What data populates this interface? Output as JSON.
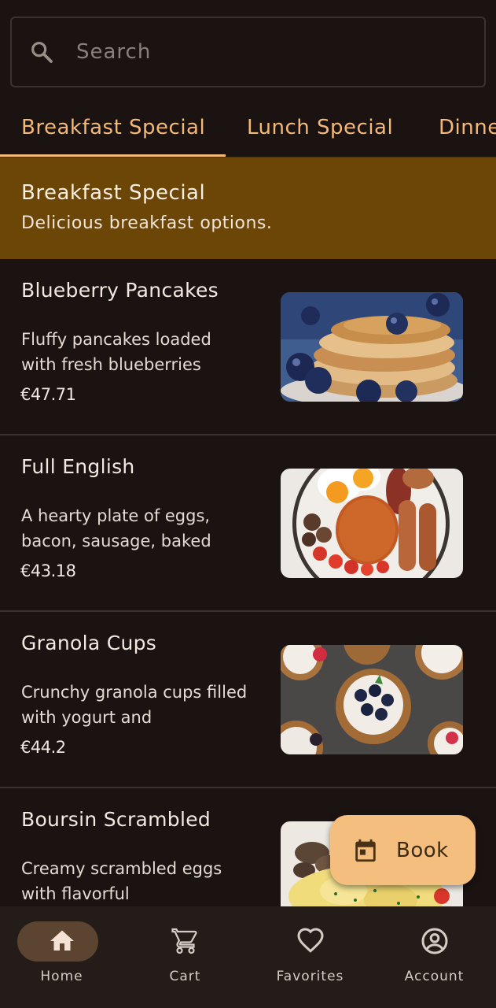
{
  "search": {
    "placeholder": "Search"
  },
  "tabs": [
    {
      "label": "Breakfast Special",
      "active": true
    },
    {
      "label": "Lunch Special",
      "active": false
    },
    {
      "label": "Dinner Special",
      "active": false
    }
  ],
  "banner": {
    "title": "Breakfast Special",
    "subtitle": "Delicious breakfast options."
  },
  "items": [
    {
      "name": "Blueberry Pancakes",
      "description": "Fluffy pancakes loaded with fresh blueberries",
      "price": "€47.71",
      "image": "blueberry-pancakes"
    },
    {
      "name": "Full English",
      "description": "A hearty plate of eggs, bacon, sausage, baked",
      "price": "€43.18",
      "image": "full-english-breakfast"
    },
    {
      "name": "Granola Cups",
      "description": "Crunchy granola cups filled with yogurt and",
      "price": "€44.2",
      "image": "granola-cups"
    },
    {
      "name": "Boursin Scrambled",
      "description": "Creamy scrambled eggs with flavorful",
      "price": "",
      "image": "boursin-scrambled-eggs"
    }
  ],
  "fab": {
    "label": "Book",
    "icon": "calendar-icon"
  },
  "nav": [
    {
      "label": "Home",
      "icon": "home-icon",
      "active": true
    },
    {
      "label": "Cart",
      "icon": "cart-icon",
      "active": false
    },
    {
      "label": "Favorites",
      "icon": "heart-icon",
      "active": false
    },
    {
      "label": "Account",
      "icon": "account-icon",
      "active": false
    }
  ],
  "colors": {
    "accent": "#f4b978",
    "banner": "#6b4606",
    "background": "#1a1311",
    "nav": "#241c18",
    "fab": "#f4bf7e"
  }
}
